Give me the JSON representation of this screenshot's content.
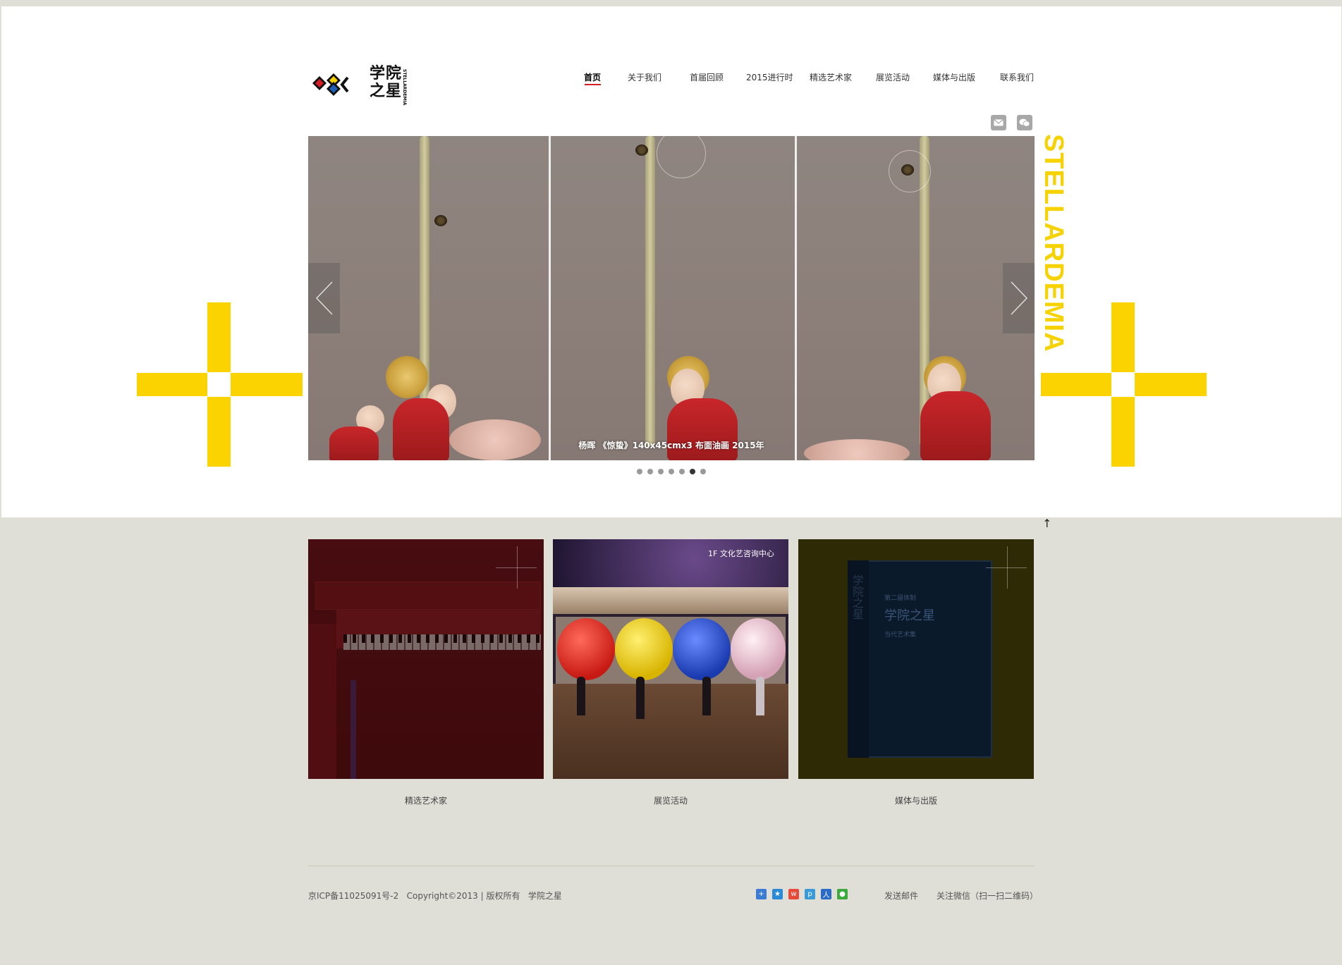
{
  "site": {
    "logo_text_line1": "学院",
    "logo_text_line2": "之星",
    "logo_side": "STELLARDEMIA"
  },
  "nav": {
    "items": [
      {
        "label": "首页",
        "active": true
      },
      {
        "label": "关于我们"
      },
      {
        "label": "首届回顾"
      },
      {
        "label": "2015进行时"
      },
      {
        "label": "精选艺术家"
      },
      {
        "label": "展览活动"
      },
      {
        "label": "媒体与出版"
      },
      {
        "label": "联系我们"
      }
    ]
  },
  "social": {
    "email_icon": "mail-icon",
    "wechat_icon": "wechat-icon"
  },
  "slider": {
    "caption": "杨晖 《惊蛰》140x45cmx3 布面油画 2015年",
    "dot_count": 7,
    "active_dot": 6,
    "side_text": "STELLARDEMIA"
  },
  "tiles": [
    {
      "label": "精选艺术家"
    },
    {
      "label": "展览活动",
      "sign": "1F 文化艺咨询中心"
    },
    {
      "label": "媒体与出版",
      "book_title": "学院之星",
      "book_sub1": "第二届体制",
      "book_sub2": "当代艺术集",
      "book_spine": "学院之星"
    }
  ],
  "footer": {
    "copyright": "京ICP备11025091号-2   Copyright©2013 | 版权所有   学院之星",
    "send_mail": "发送邮件",
    "follow_wechat": "关注微信（扫一扫二维码）"
  },
  "colors": {
    "accent_yellow": "#fbd400",
    "nav_active_underline": "#d41c25",
    "page_bg": "#dfdfd7"
  }
}
